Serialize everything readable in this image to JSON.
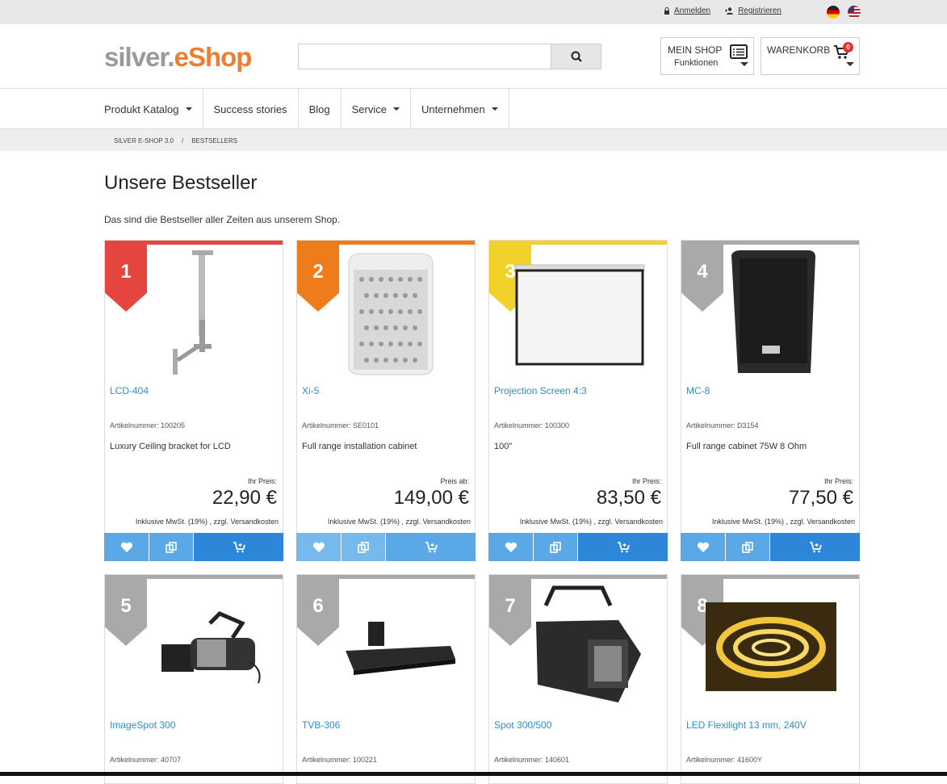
{
  "topbar": {
    "login": "Anmelden",
    "register": "Registrieren",
    "flags": [
      "de",
      "us"
    ]
  },
  "header": {
    "logo_part1": "silver.",
    "logo_part2": "eShop",
    "search_placeholder": "",
    "search_icon": "search-icon",
    "my_shop_label": "MEIN SHOP",
    "my_shop_sub": "Funktionen",
    "cart_label": "WARENKORB",
    "cart_count": "0"
  },
  "nav": {
    "items": [
      {
        "label": "Produkt Katalog",
        "dropdown": true
      },
      {
        "label": "Success stories",
        "dropdown": false
      },
      {
        "label": "Blog",
        "dropdown": false
      },
      {
        "label": "Service",
        "dropdown": true
      },
      {
        "label": "Unternehmen",
        "dropdown": true
      }
    ]
  },
  "breadcrumb": {
    "items": [
      "SILVER E-SHOP 3.0",
      "BESTSELLERS"
    ],
    "separator": "/"
  },
  "page": {
    "title": "Unsere Bestseller",
    "intro": "Das sind die Bestseller aller Zeiten aus unserem Shop."
  },
  "colors": {
    "accent": "#2a8fd6",
    "logo_orange": "#ef7c2f",
    "rank1": "#e5453f",
    "rank2": "#ef7c1a",
    "rank3": "#f2d22a",
    "rank_other": "#a9a9a9"
  },
  "products": [
    {
      "rank": "1",
      "name": "LCD-404",
      "part": "Artikelnummer: 100205",
      "desc": "Luxury Ceiling bracket for LCD",
      "price_label": "Ihr Preis:",
      "price": "22,90 €",
      "tax": "Inklusive MwSt. (19%) , zzgl. Versandkosten"
    },
    {
      "rank": "2",
      "name": "Xi-5",
      "part": "Artikelnummer: SE0101",
      "desc": "Full range installation cabinet",
      "price_label": "Preis ab:",
      "price": "149,00 €",
      "tax": "Inklusive MwSt. (19%) , zzgl. Versandkosten"
    },
    {
      "rank": "3",
      "name": "Projection Screen 4:3",
      "part": "Artikelnummer: 100300",
      "desc": "100\"",
      "price_label": "Ihr Preis:",
      "price": "83,50 €",
      "tax": "Inklusive MwSt. (19%) , zzgl. Versandkosten"
    },
    {
      "rank": "4",
      "name": "MC-8",
      "part": "Artikelnummer: D3154",
      "desc": "Full range cabinet 75W 8 Ohm",
      "price_label": "Ihr Preis:",
      "price": "77,50 €",
      "tax": "Inklusive MwSt. (19%) , zzgl. Versandkosten"
    },
    {
      "rank": "5",
      "name": "ImageSpot 300",
      "part": "Artikelnummer: 40707"
    },
    {
      "rank": "6",
      "name": "TVB-306",
      "part": "Artikelnummer: 100221"
    },
    {
      "rank": "7",
      "name": "Spot 300/500",
      "part": "Artikelnummer: 140601"
    },
    {
      "rank": "8",
      "name": "LED Flexilight 13 mm, 240V",
      "part": "Artikelnummer: 41600Y"
    }
  ]
}
